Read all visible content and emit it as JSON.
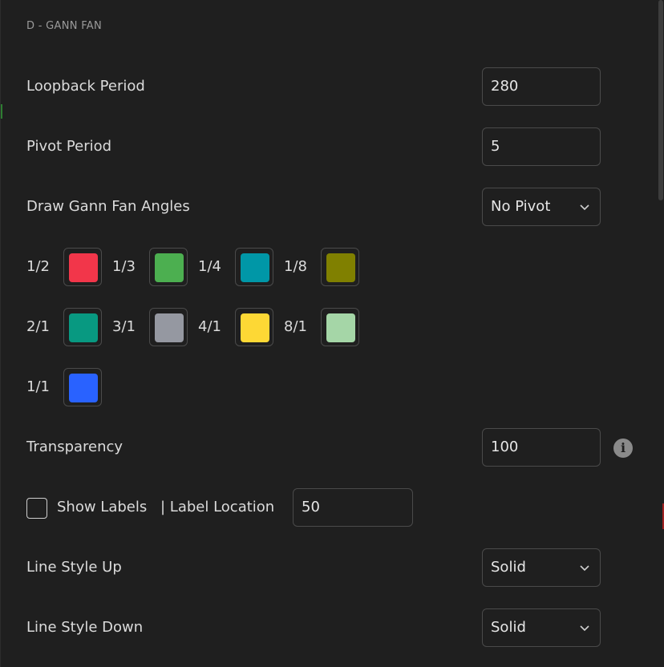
{
  "section": {
    "title": "D - GANN FAN"
  },
  "loopback": {
    "label": "Loopback Period",
    "value": "280"
  },
  "pivot": {
    "label": "Pivot Period",
    "value": "5"
  },
  "angles": {
    "label": "Draw Gann Fan Angles",
    "value": "No Pivot"
  },
  "colors_row1": [
    {
      "label": "1/2",
      "color": "#f2364a"
    },
    {
      "label": "1/3",
      "color": "#4caf50"
    },
    {
      "label": "1/4",
      "color": "#0097a7"
    },
    {
      "label": "1/8",
      "color": "#808000"
    }
  ],
  "colors_row2": [
    {
      "label": "2/1",
      "color": "#089981"
    },
    {
      "label": "3/1",
      "color": "#9598a1"
    },
    {
      "label": "4/1",
      "color": "#fdd835"
    },
    {
      "label": "8/1",
      "color": "#a5d6a7"
    }
  ],
  "colors_row3": [
    {
      "label": "1/1",
      "color": "#2962ff"
    }
  ],
  "transparency": {
    "label": "Transparency",
    "value": "100",
    "info_icon": "info-icon"
  },
  "labels": {
    "show_label": "Show Labels",
    "show_checked": false,
    "location_label": "| Label Location",
    "location_value": "50"
  },
  "line_up": {
    "label": "Line Style Up",
    "value": "Solid"
  },
  "line_down": {
    "label": "Line Style Down",
    "value": "Solid"
  }
}
